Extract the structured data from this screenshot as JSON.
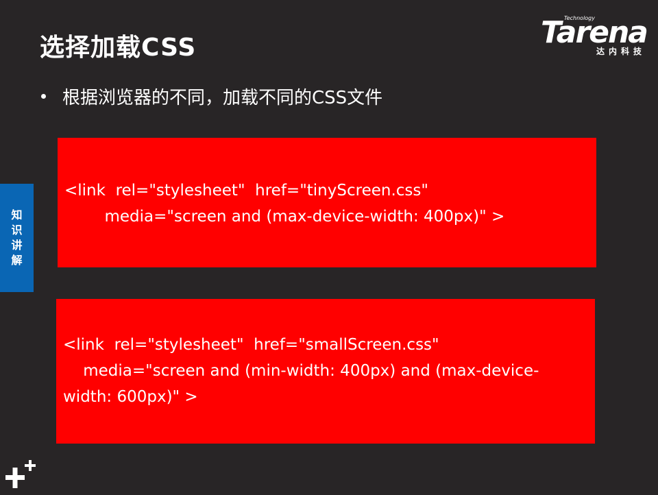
{
  "slide": {
    "title": "选择加载CSS",
    "bullet": "根据浏览器的不同，加载不同的CSS文件"
  },
  "logo": {
    "small": "Technology",
    "brand": "Tarena",
    "cn": "达内科技"
  },
  "side_tab": {
    "chars": [
      "知",
      "识",
      "讲",
      "解"
    ]
  },
  "code_blocks": [
    {
      "lines": [
        "<link  rel=\"stylesheet\"  href=\"tinyScreen.css\"",
        "        media=\"screen and (max-device-width: 400px)\" >"
      ]
    },
    {
      "lines": [
        "<link  rel=\"stylesheet\"  href=\"smallScreen.css\"",
        "    media=\"screen and (min-width: 400px) and (max-device-",
        "width: 600px)\" >"
      ]
    }
  ],
  "colors": {
    "background": "#282526",
    "code_box": "#ff0000",
    "side_tab": "#0a66b4"
  },
  "icons": [
    "plus-plus-icon"
  ]
}
